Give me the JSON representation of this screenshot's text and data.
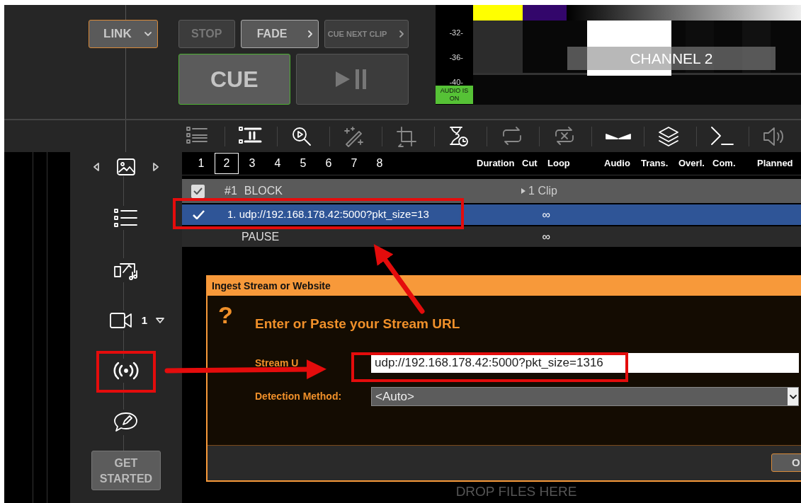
{
  "transport": {
    "link": "LINK",
    "stop": "STOP",
    "fade": "FADE",
    "cue_next": "CUE NEXT CLIP",
    "cue": "CUE"
  },
  "preview": {
    "meter_labels": [
      "-32-",
      "-36-",
      "-40-"
    ],
    "audio_status": "AUDIO IS ON",
    "channel": "CHANNEL 2"
  },
  "toolbar": [
    {
      "kind": "list",
      "disabled": true
    },
    {
      "kind": "pause-list",
      "disabled": false
    },
    {
      "kind": "preview",
      "disabled": false
    },
    {
      "kind": "magic",
      "disabled": true
    },
    {
      "kind": "crop",
      "disabled": true
    },
    {
      "kind": "timer",
      "disabled": false
    },
    {
      "kind": "loop",
      "disabled": true
    },
    {
      "kind": "shuffle",
      "disabled": true
    },
    {
      "kind": "transition",
      "disabled": false
    },
    {
      "kind": "layers",
      "disabled": false
    },
    {
      "kind": "command",
      "disabled": false
    },
    {
      "kind": "audio",
      "disabled": true
    }
  ],
  "sidebar": {
    "camera_count": "1",
    "get_started": "GET STARTED"
  },
  "playlist_tabs": [
    {
      "label": "1",
      "selected": false
    },
    {
      "label": "2",
      "selected": true
    },
    {
      "label": "3",
      "selected": false
    },
    {
      "label": "4",
      "selected": false
    },
    {
      "label": "5",
      "selected": false
    },
    {
      "label": "6",
      "selected": false
    },
    {
      "label": "7",
      "selected": false
    },
    {
      "label": "8",
      "selected": false
    }
  ],
  "columns": [
    "Duration",
    "Cut",
    "Loop",
    "Audio",
    "Trans.",
    "Overl.",
    "Com.",
    "Planned"
  ],
  "rows": [
    {
      "kind": "block",
      "checked": true,
      "number": "#1",
      "title": "BLOCK",
      "duration": "1 Clip"
    },
    {
      "kind": "clip",
      "checked": true,
      "selected": true,
      "title": "1. udp://192.168.178.42:5000?pkt_size=13",
      "duration": "∞"
    },
    {
      "kind": "pause",
      "selected": false,
      "title": "PAUSE",
      "duration": "∞"
    }
  ],
  "dialog": {
    "title": "Ingest Stream or Website",
    "icon": "?",
    "heading": "Enter or Paste your Stream URL",
    "fields": [
      {
        "kind": "text",
        "label": "Stream U",
        "value": "udp://192.168.178.42:5000?pkt_size=1316"
      },
      {
        "kind": "select",
        "label": "Detection Method:",
        "value": "<Auto>"
      }
    ],
    "ok": "O"
  },
  "drop_hint": "DROP FILES HERE"
}
